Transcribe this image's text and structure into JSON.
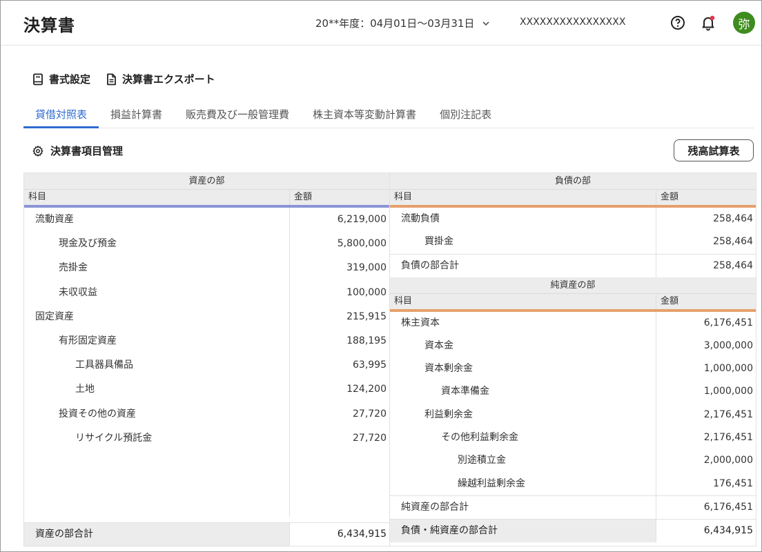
{
  "header": {
    "title": "決算書",
    "period": "20**年度：04月01日〜03月31日",
    "company": "XXXXXXXXXXXXXXXX",
    "avatar": "弥"
  },
  "actions": {
    "format_settings": "書式設定",
    "export": "決算書エクスポート"
  },
  "tabs": [
    "貸借対照表",
    "損益計算書",
    "販売費及び一般管理費",
    "株主資本等変動計算書",
    "個別注記表"
  ],
  "manage": {
    "label": "決算書項目管理"
  },
  "trial_balance_button": "残高試算表",
  "assets": {
    "section_title": "資産の部",
    "col_item": "科目",
    "col_amount": "金額",
    "rows": [
      {
        "name": "流動資産",
        "amount": "6,219,000"
      },
      {
        "name": "現金及び預金",
        "amount": "5,800,000"
      },
      {
        "name": "売掛金",
        "amount": "319,000"
      },
      {
        "name": "未収収益",
        "amount": "100,000"
      },
      {
        "name": "固定資産",
        "amount": "215,915"
      },
      {
        "name": "有形固定資産",
        "amount": "188,195"
      },
      {
        "name": "工具器具備品",
        "amount": "63,995"
      },
      {
        "name": "土地",
        "amount": "124,200"
      },
      {
        "name": "投資その他の資産",
        "amount": "27,720"
      },
      {
        "name": "リサイクル預託金",
        "amount": "27,720"
      }
    ],
    "total": {
      "name": "資産の部合計",
      "amount": "6,434,915"
    }
  },
  "liabilities": {
    "section_title": "負債の部",
    "col_item": "科目",
    "col_amount": "金額",
    "rows": [
      {
        "name": "流動負債",
        "amount": "258,464"
      },
      {
        "name": "買掛金",
        "amount": "258,464"
      }
    ],
    "subtotal": {
      "name": "負債の部合計",
      "amount": "258,464"
    }
  },
  "net_assets": {
    "section_title": "純資産の部",
    "col_item": "科目",
    "col_amount": "金額",
    "rows": [
      {
        "name": "株主資本",
        "amount": "6,176,451"
      },
      {
        "name": "資本金",
        "amount": "3,000,000"
      },
      {
        "name": "資本剰余金",
        "amount": "1,000,000"
      },
      {
        "name": "資本準備金",
        "amount": "1,000,000"
      },
      {
        "name": "利益剰余金",
        "amount": "2,176,451"
      },
      {
        "name": "その他利益剰余金",
        "amount": "2,176,451"
      },
      {
        "name": "別途積立金",
        "amount": "2,000,000"
      },
      {
        "name": "繰越利益剰余金",
        "amount": "176,451"
      }
    ],
    "subtotal": {
      "name": "純資産の部合計",
      "amount": "6,176,451"
    }
  },
  "grand_total": {
    "name": "負債・純資産の部合計",
    "amount": "6,434,915"
  },
  "colors": {
    "accent": "#2f6bd1",
    "avatar": "#3f8c1e",
    "assets_rule": "#8b93d6",
    "liab_rule": "#e6a06a",
    "bell_dot": "#e8334a"
  },
  "icons": [
    "help-icon",
    "bell-icon",
    "document-icon",
    "file-icon",
    "gear-icon",
    "chevron-down-icon"
  ]
}
